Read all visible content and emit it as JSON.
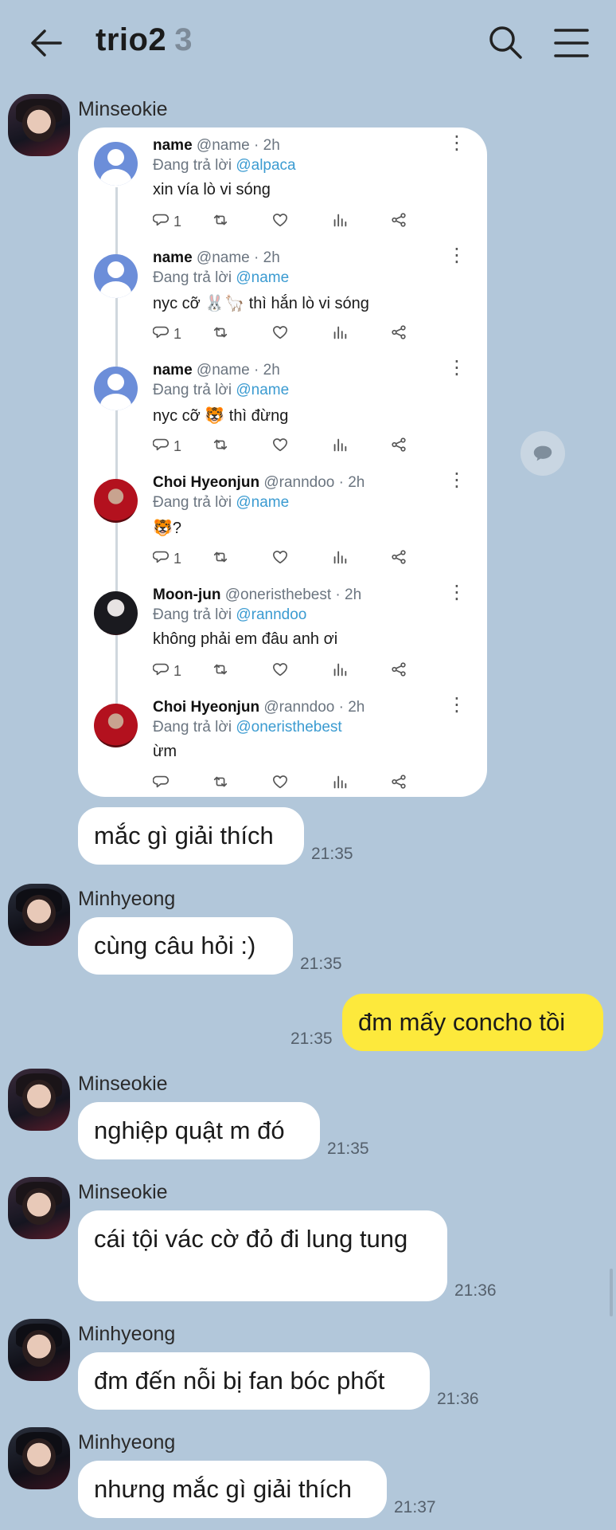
{
  "header": {
    "title": "trio2",
    "member_count": "3"
  },
  "card": {
    "tweets": [
      {
        "name": "name",
        "handle": "@name · 2h",
        "reply_prefix": "Đang trả lời",
        "reply_to": "@alpaca",
        "text": "xin vía lò vi sóng",
        "replies": "1",
        "avatar": "default"
      },
      {
        "name": "name",
        "handle": "@name · 2h",
        "reply_prefix": "Đang trả lời",
        "reply_to": "@name",
        "text": "nyc cỡ 🐰🦙 thì hắn lò vi sóng",
        "replies": "1",
        "avatar": "default"
      },
      {
        "name": "name",
        "handle": "@name · 2h",
        "reply_prefix": "Đang trả lời",
        "reply_to": "@name",
        "text": "nyc cỡ 🐯 thì đừng",
        "replies": "1",
        "avatar": "default"
      },
      {
        "name": "Choi Hyeonjun",
        "handle": "@ranndoo · 2h",
        "reply_prefix": "Đang trả lời",
        "reply_to": "@name",
        "text": "🐯?",
        "replies": "1",
        "avatar": "photo-red"
      },
      {
        "name": "Moon-jun",
        "handle": "@oneristhebest · 2h",
        "reply_prefix": "Đang trả lời",
        "reply_to": "@ranndoo",
        "text": "không phải em đâu anh ơi",
        "replies": "1",
        "avatar": "photo-dark"
      },
      {
        "name": "Choi Hyeonjun",
        "handle": "@ranndoo · 2h",
        "reply_prefix": "Đang trả lời",
        "reply_to": "@oneristhebest",
        "text": "ừm",
        "replies": "",
        "avatar": "photo-red"
      }
    ]
  },
  "messages": [
    {
      "sender": "Minseokie",
      "text": "",
      "time": ""
    },
    {
      "sender": "",
      "text": "mắc gì giải thích",
      "time": "21:35"
    },
    {
      "sender": "Minhyeong",
      "text": "cùng câu hỏi :)",
      "time": "21:35"
    },
    {
      "sender": "me",
      "text": "đm mấy concho tồi",
      "time": "21:35"
    },
    {
      "sender": "Minseokie",
      "text": "nghiệp quật m đó",
      "time": "21:35"
    },
    {
      "sender": "Minseokie",
      "text": "cái tội vác cờ đỏ đi lung tung",
      "time": "21:36"
    },
    {
      "sender": "Minhyeong",
      "text": "đm đến nỗi bị fan bóc phốt",
      "time": "21:36"
    },
    {
      "sender": "Minhyeong",
      "text": "nhưng mắc gì giải thích",
      "time": "21:37"
    }
  ],
  "colors": {
    "background": "#b2c7da",
    "my_bubble": "#fde93c",
    "mention": "#3b9bd1"
  },
  "icons": [
    "back-arrow-icon",
    "search-icon",
    "menu-icon",
    "reply-icon",
    "retweet-icon",
    "like-icon",
    "views-icon",
    "share-icon",
    "more-icon",
    "chat-bubble-icon"
  ]
}
